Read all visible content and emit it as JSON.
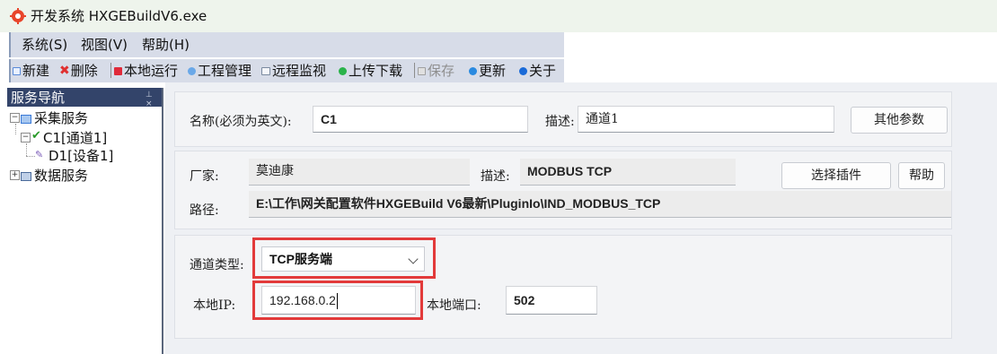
{
  "window": {
    "title": "开发系统 HXGEBuildV6.exe"
  },
  "menu": [
    "系统(S)",
    "视图(V)",
    "帮助(H)"
  ],
  "toolbar": {
    "new": "新建",
    "delete": "删除",
    "run_local": "本地运行",
    "project_mgmt": "工程管理",
    "remote_monitor": "远程监视",
    "upload_download": "上传下载",
    "save": "保存",
    "update": "更新",
    "about": "关于"
  },
  "nav": {
    "title": "服务导航",
    "collect_service": "采集服务",
    "channel": "C1[通道1]",
    "device": "D1[设备1]",
    "data_service": "数据服务"
  },
  "channel_info": {
    "name_label": "名称(必须为英文):",
    "name_value": "C1",
    "desc_label": "描述:",
    "desc_value": "通道1",
    "other_params_button": "其他参数"
  },
  "plugin_info": {
    "vendor_label": "厂家:",
    "vendor_value": "莫迪康",
    "desc_label": "描述:",
    "desc_value": "MODBUS TCP",
    "select_plugin_button": "选择插件",
    "help_button": "帮助",
    "path_label": "路径:",
    "path_value": "E:\\工作\\网关配置软件HXGEBuild V6最新\\PluginIo\\IND_MODBUS_TCP"
  },
  "connection": {
    "channel_type_label": "通道类型:",
    "channel_type_value": "TCP服务端",
    "local_ip_label": "本地IP:",
    "local_ip_value": "192.168.0.2",
    "local_port_label": "本地端口:",
    "local_port_value": "502"
  },
  "colors": {
    "highlight": "#e23a3a",
    "nav_header": "#33446a",
    "toolbar_bg": "#d7dce8"
  }
}
